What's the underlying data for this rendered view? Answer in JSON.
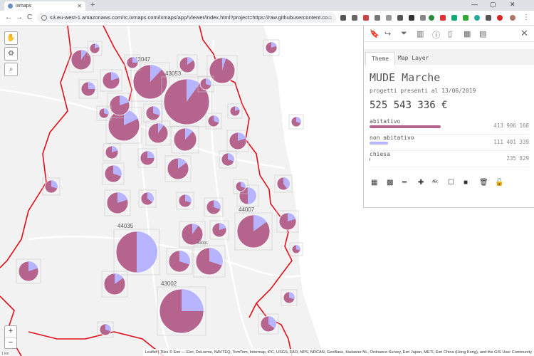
{
  "browser": {
    "tab_title": "ixmaps",
    "new_tab": "+",
    "url": "s3.eu-west-1.amazonaws.com/rc.ixmaps.com/ixmaps/app/Viewer/index.html?project=https://raw.githubusercontent.co...",
    "back": "←",
    "forward": "→",
    "reload": "C",
    "window_minimize": "—",
    "window_maximize": "▢",
    "window_close": "✕"
  },
  "map": {
    "attribution": "Leaflet | Tiles © Esri — Esri, DeLorme, NAVTEQ, TomTom, Intermap, iPC, USGS, FAO, NPS, NRCAN, GeoBase, Kadaster NL, Ordnance Survey, Esri Japan, METI, Esri China (Hong Kong), and the GIS User Community",
    "scale_text": "1 km",
    "zoom_in": "+",
    "zoom_out": "−",
    "labels": [
      "43047",
      "43053",
      "44035",
      "44001",
      "44007",
      "43002"
    ],
    "colors": {
      "abitativo": "#b5648e",
      "non_abitativo": "#b7b5ff",
      "border": "#e0101a",
      "sea": "#ffffff",
      "land": "#f2f2f2"
    }
  },
  "panel": {
    "tabs": [
      "Theme",
      "Map Layer"
    ],
    "title": "MUDE Marche",
    "subtitle": "progetti presenti al 13/06/2019",
    "total": "525 543 336 €",
    "categories": [
      {
        "label": "abitativo",
        "value": "413 906 168",
        "share": 0.79,
        "color": "#b5648e"
      },
      {
        "label": "non abitativo",
        "value": "111 401 339",
        "share": 0.21,
        "color": "#b7b5ff"
      },
      {
        "label": "chiesa",
        "value": "235 829",
        "share": 0.005,
        "color": "#b5648e"
      }
    ],
    "close": "✕"
  }
}
